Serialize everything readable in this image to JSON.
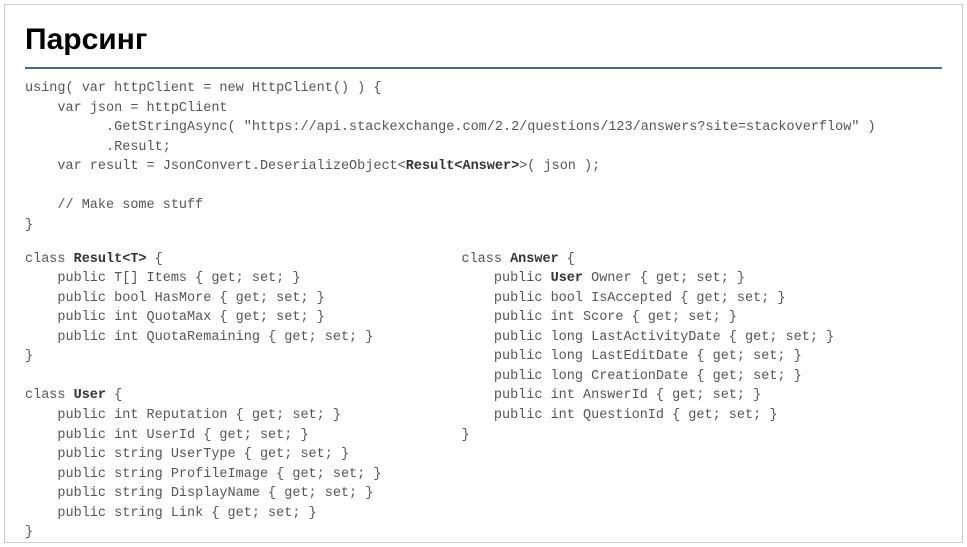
{
  "title": "Парсинг",
  "code": {
    "top": {
      "l1": "using( var httpClient = new HttpClient() ) {",
      "l2": "    var json = httpClient",
      "l3": "          .GetStringAsync( \"https://api.stackexchange.com/2.2/questions/123/answers?site=stackoverflow\" )",
      "l4": "          .Result;",
      "l5a": "    var result = JsonConvert.DeserializeObject<",
      "l5b": "Result<Answer>",
      "l5c": ">( json );",
      "l6": "",
      "l7": "    // Make some stuff",
      "l8": "}"
    },
    "left": {
      "r1a": "class ",
      "r1b": "Result<T>",
      "r1c": " {",
      "r2": "    public T[] Items { get; set; }",
      "r3": "    public bool HasMore { get; set; }",
      "r4": "    public int QuotaMax { get; set; }",
      "r5": "    public int QuotaRemaining { get; set; }",
      "r6": "}",
      "r7": "",
      "u1a": "class ",
      "u1b": "User",
      "u1c": " {",
      "u2": "    public int Reputation { get; set; }",
      "u3": "    public int UserId { get; set; }",
      "u4": "    public string UserType { get; set; }",
      "u5": "    public string ProfileImage { get; set; }",
      "u6": "    public string DisplayName { get; set; }",
      "u7": "    public string Link { get; set; }",
      "u8": "}"
    },
    "right": {
      "a1a": "class ",
      "a1b": "Answer",
      "a1c": " {",
      "a2a": "    public ",
      "a2b": "User",
      "a2c": " Owner { get; set; }",
      "a3": "    public bool IsAccepted { get; set; }",
      "a4": "    public int Score { get; set; }",
      "a5": "    public long LastActivityDate { get; set; }",
      "a6": "    public long LastEditDate { get; set; }",
      "a7": "    public long CreationDate { get; set; }",
      "a8": "    public int AnswerId { get; set; }",
      "a9": "    public int QuestionId { get; set; }",
      "a10": "}"
    }
  }
}
